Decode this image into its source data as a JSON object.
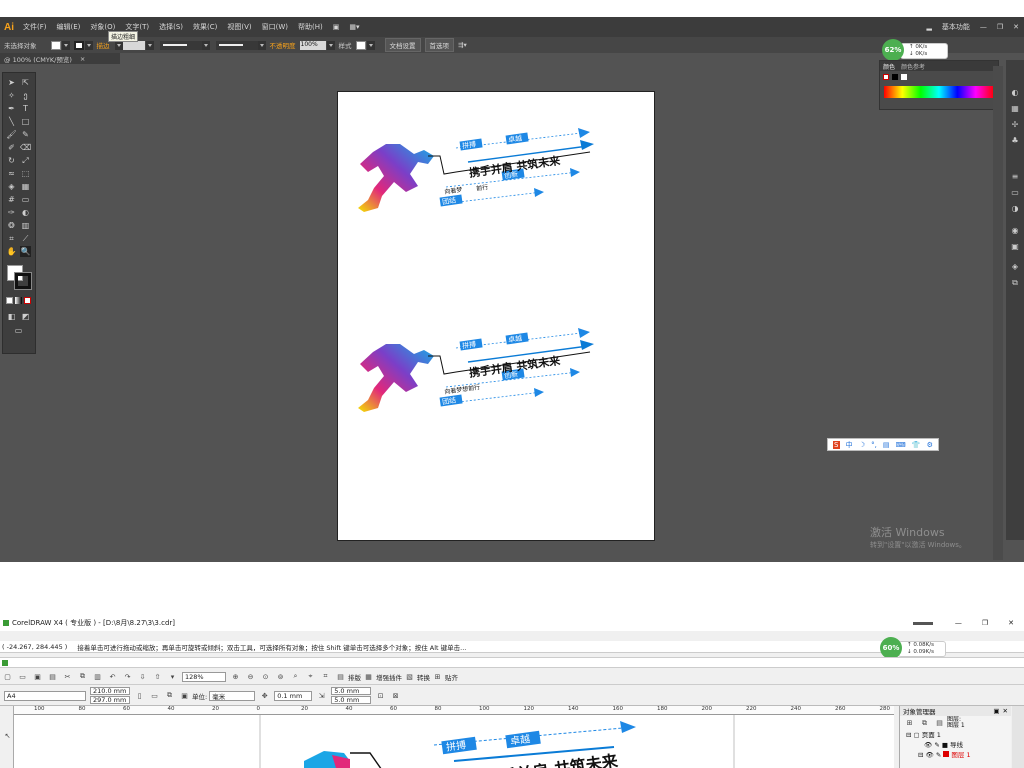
{
  "ai": {
    "menus": [
      "文件(F)",
      "编辑(E)",
      "对象(O)",
      "文字(T)",
      "选择(S)",
      "效果(C)",
      "视图(V)",
      "窗口(W)",
      "帮助(H)"
    ],
    "workspace": "基本功能",
    "tooltip": "描边粗细",
    "control": {
      "selection": "未选择对象",
      "stroke_label": "描边",
      "stroke_profile": "等比",
      "brush": "基本",
      "opacity_label": "不透明度",
      "opacity_value": "100%",
      "style_label": "样式",
      "doc_setup": "文档设置",
      "prefs": "首选项"
    },
    "doc_tab": "@ 100% (CMYK/预览)",
    "color_panel": {
      "tab1": "颜色",
      "tab2": "颜色参考"
    },
    "net": {
      "percent": "62%",
      "up": "0K/s",
      "down": "0K/s"
    },
    "activate_line1": "激活 Windows",
    "activate_line2": "转到\"设置\"以激活 Windows。",
    "ime": [
      "中",
      "☽",
      "°,",
      "▤",
      "⌨",
      "👕",
      "⚙"
    ]
  },
  "logo": {
    "headline": "携手并肩 共筑未来",
    "tag1": "拼搏",
    "tag2": "卓越",
    "tag3": "团结",
    "line1_a": "向着梦",
    "line1_b": "前行",
    "line1_full": "向着梦想前行",
    "tag4": "创新"
  },
  "cdr": {
    "title": "CorelDRAW X4 ( 专业版 ) - [D:\\8月\\8.27\\3\\3.cdr]",
    "coords": "( -24.267, 284.445 )",
    "status": "接着单击可进行拖动或缩放；再单击可旋转或倾斜；双击工具，可选择所有对象；按住 Shift 键单击可选择多个对象；按住 Alt 键单击...",
    "zoom": "128%",
    "tb_labels": [
      "排版",
      "增强插件",
      "转换",
      "贴齐"
    ],
    "page_size": "A4",
    "width": "210.0 mm",
    "height": "297.0 mm",
    "units_label": "单位:",
    "units": "毫米",
    "nudge": "0.1 mm",
    "dup_x": "5.0 mm",
    "dup_y": "5.0 mm",
    "ruler": [
      "100",
      "80",
      "60",
      "40",
      "20",
      "0",
      "20",
      "40",
      "60",
      "80",
      "100",
      "120",
      "140",
      "160",
      "180",
      "200",
      "220",
      "240",
      "260",
      "280"
    ],
    "net": {
      "percent": "60%",
      "up": "0.08K/s",
      "down": "0.09K/s"
    },
    "objmgr": {
      "title": "对象管理器",
      "layer": "图层:",
      "layer_val": "图层 1",
      "page": "页面 1",
      "guide": "导线",
      "layer1": "图层 1"
    }
  }
}
